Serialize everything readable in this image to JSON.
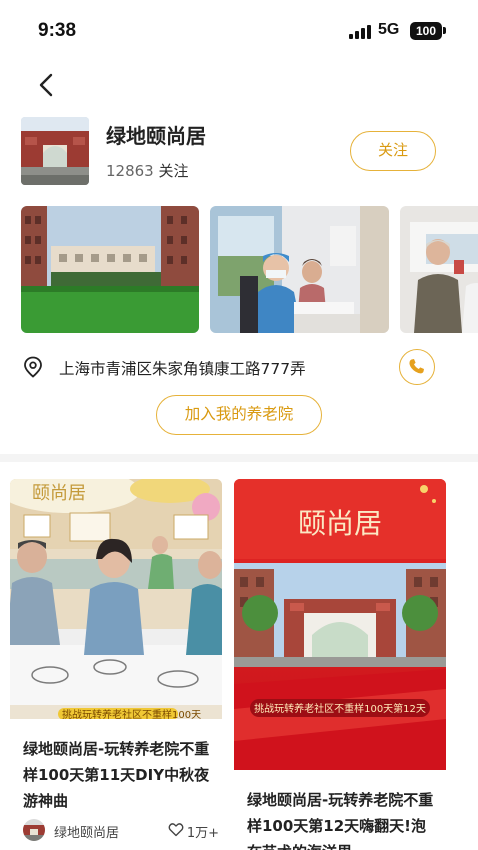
{
  "status_bar": {
    "time": "9:38",
    "network": "5G",
    "battery": "100"
  },
  "icons": {
    "back": "chevron-left-icon",
    "location": "map-pin-icon",
    "phone": "phone-icon",
    "like": "heart-icon"
  },
  "colors": {
    "accent": "#e6b23a",
    "accent_text": "#d99a11",
    "divider": "#f4f4f4"
  },
  "header": {
    "name": "绿地颐尚居",
    "followers": "12863",
    "followers_label": "关注",
    "follow_button": "关注"
  },
  "address": {
    "text": "上海市青浦区朱家角镇康工路777弄"
  },
  "join_button": "加入我的养老院",
  "feed": [
    {
      "image_banner": "挑战玩转养老社区不重样100天",
      "title": "绿地颐尚居-玩转养老院不重样100天第11天DIY中秋夜游神曲",
      "author": "绿地颐尚居",
      "likes": "1万+"
    },
    {
      "image_heading": "颐尚居",
      "image_banner": "挑战玩转养老社区不重样100天第12天",
      "title": "绿地颐尚居-玩转养老院不重样100天第12天嗨翻天!泡在艺术的海洋里"
    }
  ]
}
